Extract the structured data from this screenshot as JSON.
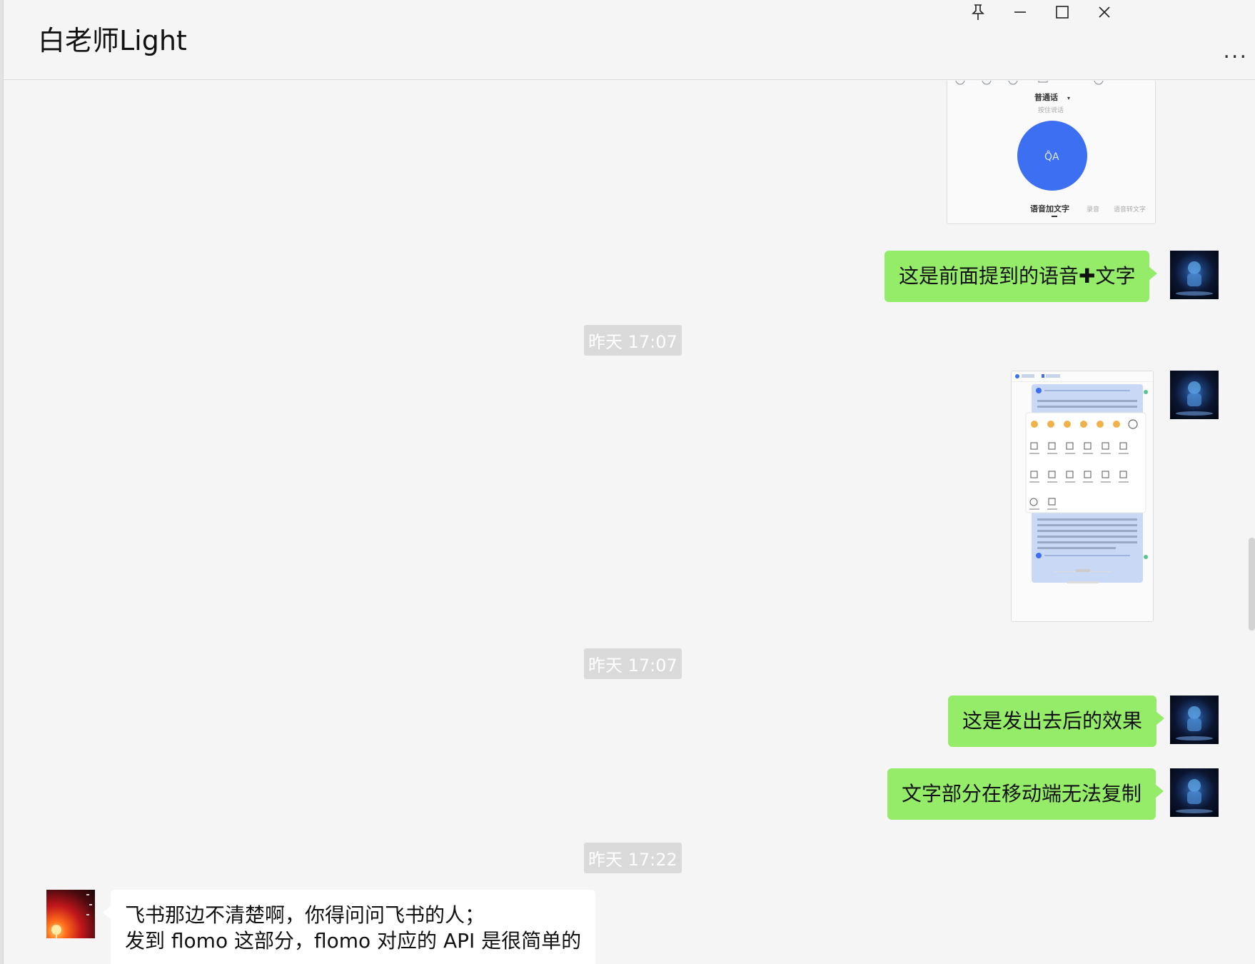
{
  "window": {
    "title": "白老师Light",
    "controls": {
      "pin": "pin-icon",
      "minimize": "minimize-icon",
      "maximize": "maximize-icon",
      "close": "close-icon"
    },
    "more_label": "..."
  },
  "image1": {
    "language_label": "普通话",
    "hint": "按住说话",
    "mic_label": "Q̊A",
    "tabs": [
      "语音加文字",
      "录音",
      "语音转文字"
    ]
  },
  "messages": {
    "msg1": "这是前面提到的语音✚文字",
    "time1": "昨天 17:07",
    "time2": "昨天 17:07",
    "msg2": "这是发出去后的效果",
    "msg3": "文字部分在移动端无法复制",
    "time3": "昨天 17:22",
    "msg4_line1": "飞书那边不清楚啊，你得问问飞书的人；",
    "msg4_line2": "发到 flomo 这部分，flomo 对应的 API 是很简单的"
  },
  "colors": {
    "self_bubble": "#95ec69",
    "other_bubble": "#ffffff",
    "timestamp_bg": "#dadada",
    "mic_button": "#3d6ff2"
  }
}
